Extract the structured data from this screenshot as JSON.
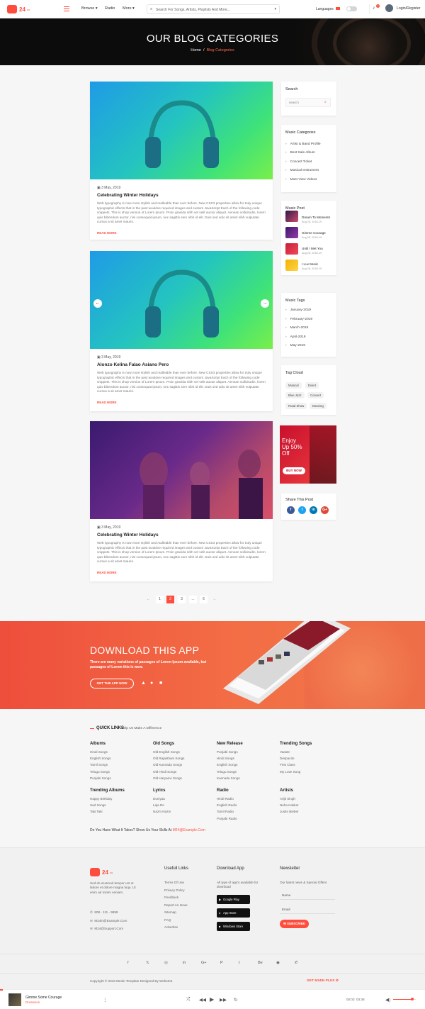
{
  "header": {
    "logo_text": "24",
    "logo_suffix": "M4",
    "nav": [
      "Browse",
      "Radio",
      "More"
    ],
    "search_placeholder": "Search For Songs, Artists, Playlists And More...",
    "languages_label": "Languages",
    "notification_count": "2",
    "login_label": "Login/Register"
  },
  "hero": {
    "title": "OUR BLOG CATEGORIES",
    "breadcrumb_home": "Home",
    "breadcrumb_sep": "/",
    "breadcrumb_current": "Blog Categories"
  },
  "posts": [
    {
      "date": "3 May, 2019",
      "title": "Celebrating Winter Holidays",
      "text": "Web typography is now more stylish and malleable than ever before. New CSS3 properties allow for truly unique typographic effects that in the past wouldve required images and custom JavaScript Each of the following code snippets. This is shop version of Lorem Ipsum. Proin gravida nibh vel velit auctor aliquet. Aenean sollicitudin, lorem quis bibendum auctor, nisi consequat ipsum, nec sagittis sem nibh id elit. Duis sed odio sit amet nibh vulputate cursus a sit amet mauris.",
      "read_more": "READ MORE"
    },
    {
      "date": "3 May, 2019",
      "title": "Alonzo Kelina Falao Asiano Pero",
      "text": "Web typography is now more stylish and malleable than ever before. New CSS3 properties allow for truly unique typographic effects that in the past wouldve required images and custom JavaScript Each of the following code snippets. This is shop version of Lorem Ipsum. Proin gravida nibh vel velit auctor aliquet. Aenean sollicitudin, lorem quis bibendum auctor, nisi consequat ipsum, nec sagittis sem nibh id elit. Duis sed odio sit amet nibh vulputate cursus a sit amet mauris.",
      "read_more": "READ MORE"
    },
    {
      "date": "3 May, 2019",
      "title": "Celebrating Winter Holidays",
      "text": "Web typography is now more stylish and malleable than ever before. New CSS3 properties allow for truly unique typographic effects that in the past wouldve required images and custom JavaScript Each of the following code snippets. This is shop version of Lorem Ipsum. Proin gravida nibh vel velit auctor aliquet. Aenean sollicitudin, lorem quis bibendum auctor, nisi consequat ipsum, nec sagittis sem nibh id elit. Duis sed odio sit amet nibh vulputate cursus a sit amet mauris.",
      "read_more": "READ MORE"
    }
  ],
  "sidebar": {
    "search_title": "Search",
    "search_placeholder": "search",
    "categories_title": "Music Categories",
    "categories": [
      "Artist & Band Profile",
      "Best Sale Album",
      "Concert Ticket",
      "Musical Instrument",
      "Most View Videos"
    ],
    "music_post_title": "Music Post",
    "music_posts": [
      {
        "name": "Dream To Moments",
        "date": "Aug 28, 2018-19"
      },
      {
        "name": "Gimme Courage",
        "date": "Aug 28, 2018-19"
      },
      {
        "name": "Until I Met You",
        "date": "Aug 28, 2018-19"
      },
      {
        "name": "I Luv Music",
        "date": "Aug 28, 2018-19"
      }
    ],
    "tags_title": "Music Tags",
    "tags": [
      "January-2019",
      "February-2019",
      "March-2019",
      "April-2019",
      "May-2019"
    ],
    "cloud_title": "Tag Cloud",
    "cloud": [
      "Musical",
      "Event",
      "Blue Jazz",
      "Concert",
      "Road Show",
      "Dancing"
    ],
    "ad_text_1": "Enjoy",
    "ad_text_2": "Up 50%",
    "ad_text_3": "Off",
    "ad_button": "BUY NOW",
    "share_title": "Share This Post",
    "share_letters": [
      "f",
      "t",
      "in",
      "G+"
    ]
  },
  "pagination": [
    "←",
    "1",
    "2",
    "3",
    "...",
    "6",
    "→"
  ],
  "app": {
    "title": "DOWNLOAD THIS APP",
    "text": "There are many variations of passages of Lorem Ipsum available, but passages of Lorem this is wow.",
    "button": "GET THE APP NOW"
  },
  "quick_links": {
    "title": "QUICK LINKS",
    "subtitle": "Help Us Make A Difference",
    "columns": [
      {
        "title": "Albums",
        "items": [
          "Hindi Songs",
          "English Songs",
          "Tamil Songs",
          "Telugu Songs",
          "Punjabi Songs"
        ]
      },
      {
        "title": "Old Songs",
        "items": [
          "Old English Songs",
          "Old Rajasthani Songs",
          "Old Kannada Songs",
          "Old Hindi Songs",
          "Old Haryanvi Songs"
        ]
      },
      {
        "title": "New Release",
        "items": [
          "Punjabi Songs",
          "Hindi Songs",
          "English Songs",
          "Telugu Songs",
          "Kannada Songs"
        ]
      },
      {
        "title": "Trending Songs",
        "items": [
          "Vaaste",
          "Despacito",
          "First Class",
          "My Love Song"
        ]
      },
      {
        "title": "Trending Albums",
        "items": [
          "Happy Birthday",
          "Sad Songs",
          "Taki Taki"
        ]
      },
      {
        "title": "Lyrics",
        "items": [
          "Duniyaa",
          "Laja Re",
          "Nazm Nazm"
        ]
      },
      {
        "title": "Radio",
        "items": [
          "Hindi Radio",
          "English Radio",
          "Tamil Radio",
          "Punjabi Radio"
        ]
      },
      {
        "title": "Artists",
        "items": [
          "Arijit Singh",
          "Neha Kakkar",
          "Justin Bieber"
        ]
      }
    ],
    "skills_text": "Do You Have What It Takes? Show Us Your Skills At",
    "skills_email": "M24@Example.Com"
  },
  "footer": {
    "about": "Sed do eiusmod tempor unt ut labore et dolore magna fuqa. Ut enim ad minim veniam.",
    "phone": "808 - 111 - 9999",
    "email1": "M24in@Example.Com",
    "email2": "M24@Support.Com",
    "useful_title": "Usefull Links",
    "useful": [
      "Terms Of Use",
      "Privacy Policy",
      "Feedback",
      "Report An Issue",
      "Sitemap",
      "FAQ",
      "Advertise"
    ],
    "download_title": "Download App",
    "download_text": "All type of app's available for download",
    "stores": [
      "Google Play",
      "App Store",
      "Windows Store"
    ],
    "newsletter_title": "Newsletter",
    "newsletter_text": "Our latest news & Special Offers",
    "name_placeholder": "Name",
    "email_placeholder": "Email",
    "subscribe": "SUBSCRIBE",
    "social": [
      "f",
      "𝕏",
      "◎",
      "in",
      "G+",
      "P",
      "t",
      "Be",
      "◉",
      "✆"
    ],
    "copyright": "Copyright © 2019 M24in Template Designed By Webstrot",
    "plus": "GET M24IN PLUS"
  },
  "player": {
    "song": "Gimme Some Courage",
    "artist": "Dreamson",
    "time_current": "00:03",
    "time_total": "03:38"
  },
  "colors": {
    "accent": "#ff4d3d",
    "brand_dark": "#222222"
  }
}
